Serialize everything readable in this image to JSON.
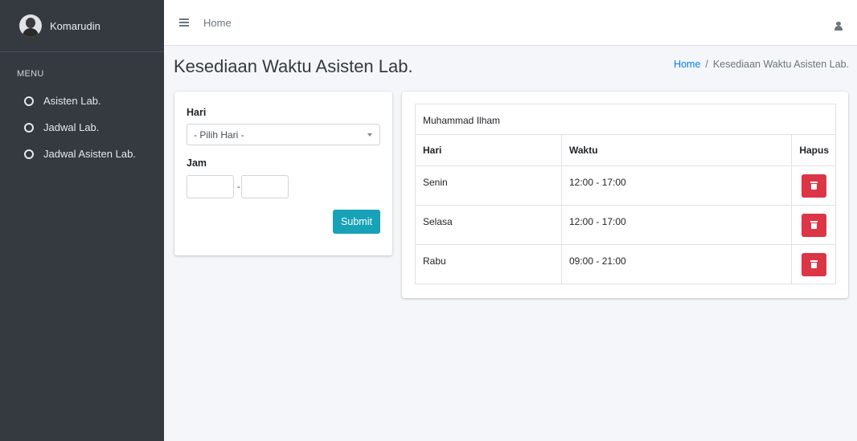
{
  "sidebar": {
    "user_name": "Komarudin",
    "menu_header": "MENU",
    "items": [
      {
        "label": "Asisten Lab.",
        "icon": "circle-icon"
      },
      {
        "label": "Jadwal Lab.",
        "icon": "circle-icon"
      },
      {
        "label": "Jadwal Asisten Lab.",
        "icon": "circle-icon"
      }
    ]
  },
  "navbar": {
    "home_link": "Home",
    "menu_icon": "hamburger-icon",
    "user_icon": "user-icon"
  },
  "page": {
    "title": "Kesediaan Waktu Asisten Lab.",
    "breadcrumb": {
      "home": "Home",
      "separator": "/",
      "current": "Kesediaan Waktu Asisten Lab."
    }
  },
  "form": {
    "hari_label": "Hari",
    "hari_selected": "- Pilih Hari -",
    "jam_label": "Jam",
    "jam_start_value": "",
    "jam_end_value": "",
    "jam_separator": "-",
    "submit_label": "Submit"
  },
  "schedule": {
    "assistant_name": "Muhammad Ilham",
    "columns": [
      "Hari",
      "Waktu",
      "Hapus"
    ],
    "rows": [
      {
        "hari": "Senin",
        "waktu": "12:00 - 17:00"
      },
      {
        "hari": "Selasa",
        "waktu": "12:00 - 17:00"
      },
      {
        "hari": "Rabu",
        "waktu": "09:00 - 21:00"
      }
    ]
  },
  "colors": {
    "sidebar_bg": "#343a40",
    "link": "#007bff",
    "submit": "#17a2b8",
    "delete": "#dc3545"
  }
}
